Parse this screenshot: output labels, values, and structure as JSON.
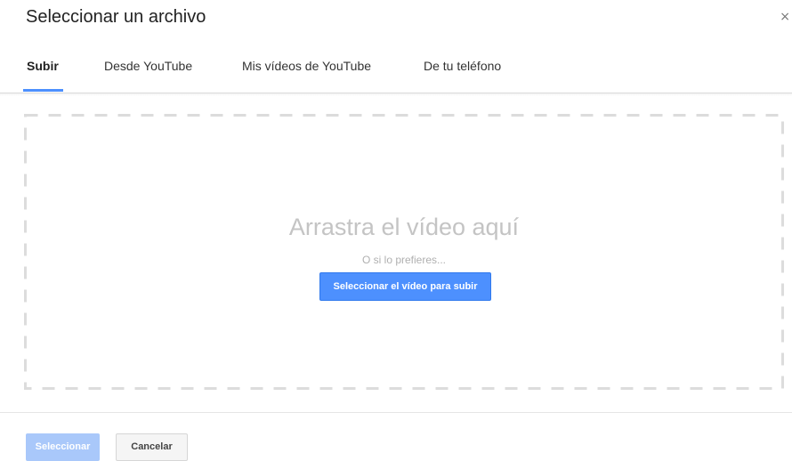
{
  "dialog": {
    "title": "Seleccionar un archivo",
    "close_icon": "close-icon",
    "close_glyph": "×"
  },
  "tabs": [
    {
      "label": "Subir",
      "active": true
    },
    {
      "label": "Desde YouTube",
      "active": false
    },
    {
      "label": "Mis vídeos de YouTube",
      "active": false
    },
    {
      "label": "De tu teléfono",
      "active": false
    }
  ],
  "dropzone": {
    "title": "Arrastra el vídeo aquí",
    "subtitle": "O si lo prefieres...",
    "button_label": "Seleccionar el vídeo para subir"
  },
  "footer": {
    "select_label": "Seleccionar",
    "cancel_label": "Cancelar"
  },
  "colors": {
    "accent": "#4d90fe",
    "accent_disabled": "#a9c8fa",
    "dash_border": "#dcdcdc",
    "drop_text": "#c4c4c4"
  }
}
